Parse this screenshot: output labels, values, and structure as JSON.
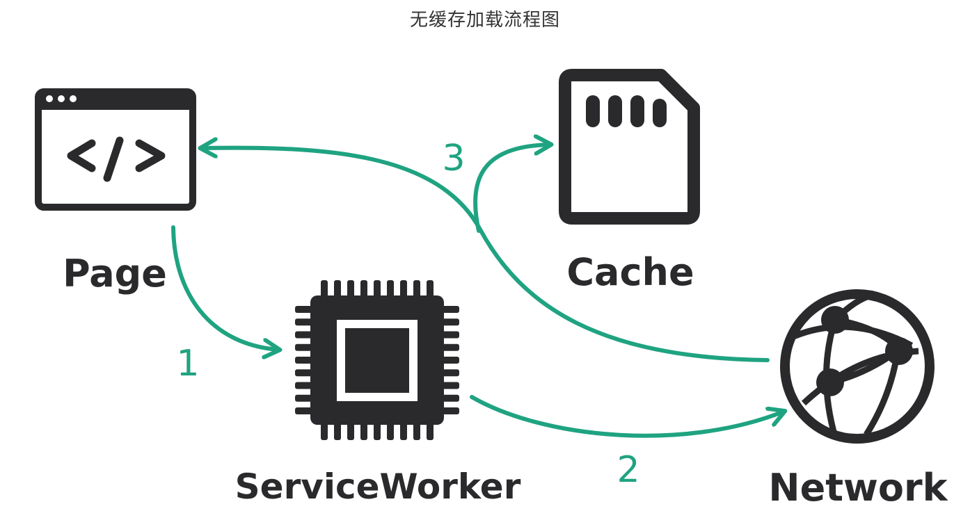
{
  "title": "无缓存加载流程图",
  "colors": {
    "ink": "#2a2a2c",
    "arrow": "#1fa381",
    "background": "#ffffff"
  },
  "nodes": {
    "page": {
      "label": "Page",
      "icon": "browser-code-icon"
    },
    "cache": {
      "label": "Cache",
      "icon": "sd-card-icon"
    },
    "service_worker": {
      "label": "ServiceWorker",
      "icon": "cpu-chip-icon"
    },
    "network": {
      "label": "Network",
      "icon": "globe-network-icon"
    }
  },
  "steps": {
    "step1": "1",
    "step2": "2",
    "step3": "3"
  }
}
